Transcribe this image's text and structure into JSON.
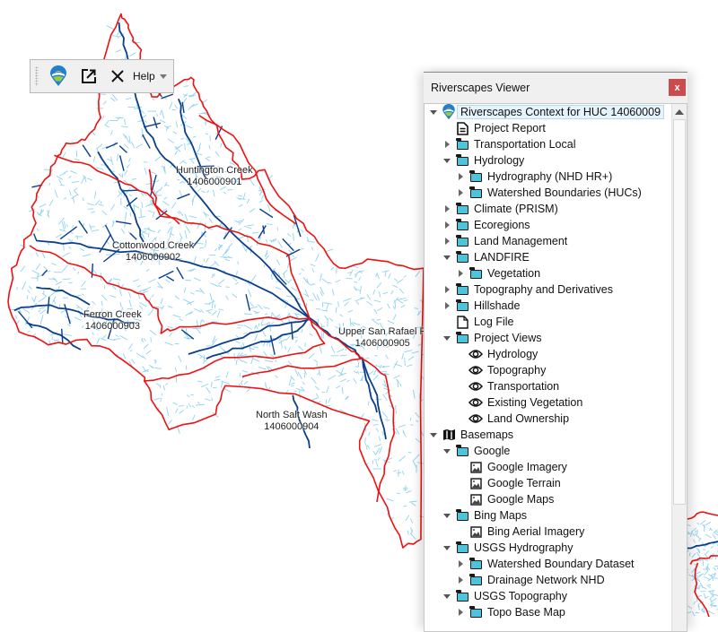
{
  "toolbar": {
    "buttons": [
      {
        "name": "riverscapes-logo",
        "icon": "riverscapes-pin-icon"
      },
      {
        "name": "open-external",
        "icon": "external-link-icon"
      },
      {
        "name": "close-project",
        "icon": "close-x-icon"
      }
    ],
    "help_label": "Help",
    "help_dropdown_icon": "caret-down-icon"
  },
  "panel": {
    "title": "Riverscapes Viewer",
    "close_label": "x",
    "scroll_position_fraction": 0.0,
    "visible_fraction": 0.75,
    "tree": [
      {
        "label": "Riverscapes Context for HUC 14060009",
        "level": 0,
        "expander": "open",
        "icon": "riverscapes-pin-icon",
        "selected": true
      },
      {
        "label": "Project Report",
        "level": 1,
        "expander": "none",
        "icon": "report-icon"
      },
      {
        "label": "Transportation Local",
        "level": 1,
        "expander": "closed",
        "icon": "folder-icon"
      },
      {
        "label": "Hydrology",
        "level": 1,
        "expander": "open",
        "icon": "folder-icon"
      },
      {
        "label": "Hydrography (NHD HR+)",
        "level": 2,
        "expander": "closed",
        "icon": "folder-icon"
      },
      {
        "label": "Watershed Boundaries (HUCs)",
        "level": 2,
        "expander": "closed",
        "icon": "folder-icon"
      },
      {
        "label": "Climate (PRISM)",
        "level": 1,
        "expander": "closed",
        "icon": "folder-icon"
      },
      {
        "label": "Ecoregions",
        "level": 1,
        "expander": "closed",
        "icon": "folder-icon"
      },
      {
        "label": "Land Management",
        "level": 1,
        "expander": "closed",
        "icon": "folder-icon"
      },
      {
        "label": "LANDFIRE",
        "level": 1,
        "expander": "open",
        "icon": "folder-icon"
      },
      {
        "label": "Vegetation",
        "level": 2,
        "expander": "closed",
        "icon": "folder-icon"
      },
      {
        "label": "Topography and Derivatives",
        "level": 1,
        "expander": "closed",
        "icon": "folder-icon"
      },
      {
        "label": "Hillshade",
        "level": 1,
        "expander": "closed",
        "icon": "folder-icon"
      },
      {
        "label": "Log File",
        "level": 1,
        "expander": "none",
        "icon": "file-icon"
      },
      {
        "label": "Project Views",
        "level": 1,
        "expander": "open",
        "icon": "folder-icon"
      },
      {
        "label": "Hydrology",
        "level": 2,
        "expander": "none",
        "icon": "eye-icon"
      },
      {
        "label": "Topography",
        "level": 2,
        "expander": "none",
        "icon": "eye-icon"
      },
      {
        "label": "Transportation",
        "level": 2,
        "expander": "none",
        "icon": "eye-icon"
      },
      {
        "label": "Existing Vegetation",
        "level": 2,
        "expander": "none",
        "icon": "eye-icon"
      },
      {
        "label": "Land Ownership",
        "level": 2,
        "expander": "none",
        "icon": "eye-icon"
      },
      {
        "label": "Basemaps",
        "level": 0,
        "expander": "open",
        "icon": "map-icon"
      },
      {
        "label": "Google",
        "level": 1,
        "expander": "open",
        "icon": "folder-icon"
      },
      {
        "label": "Google Imagery",
        "level": 2,
        "expander": "none",
        "icon": "raster-image-icon"
      },
      {
        "label": "Google Terrain",
        "level": 2,
        "expander": "none",
        "icon": "raster-image-icon"
      },
      {
        "label": "Google Maps",
        "level": 2,
        "expander": "none",
        "icon": "raster-image-icon"
      },
      {
        "label": "Bing Maps",
        "level": 1,
        "expander": "open",
        "icon": "folder-icon"
      },
      {
        "label": "Bing Aerial Imagery",
        "level": 2,
        "expander": "none",
        "icon": "raster-image-icon"
      },
      {
        "label": "USGS Hydrography",
        "level": 1,
        "expander": "open",
        "icon": "folder-icon"
      },
      {
        "label": "Watershed Boundary Dataset",
        "level": 2,
        "expander": "closed",
        "icon": "folder-icon"
      },
      {
        "label": "Drainage Network NHD",
        "level": 2,
        "expander": "closed",
        "icon": "folder-icon"
      },
      {
        "label": "USGS Topography",
        "level": 1,
        "expander": "open",
        "icon": "folder-icon"
      },
      {
        "label": "Topo Base Map",
        "level": 2,
        "expander": "closed",
        "icon": "folder-icon"
      }
    ]
  },
  "map": {
    "colors": {
      "boundary": "#ee1111",
      "major_stream": "#0a3f8c",
      "minor_stream": "#8fd3f0"
    },
    "watersheds": [
      {
        "name": "Huntington Creek",
        "huc": "1406000901"
      },
      {
        "name": "Cottonwood Creek",
        "huc": "1406000902"
      },
      {
        "name": "Ferron Creek",
        "huc": "1406000903"
      },
      {
        "name": "North Salt Wash",
        "huc": "1406000904"
      },
      {
        "name": "Upper San Rafael R",
        "huc": "1406000905"
      }
    ]
  }
}
